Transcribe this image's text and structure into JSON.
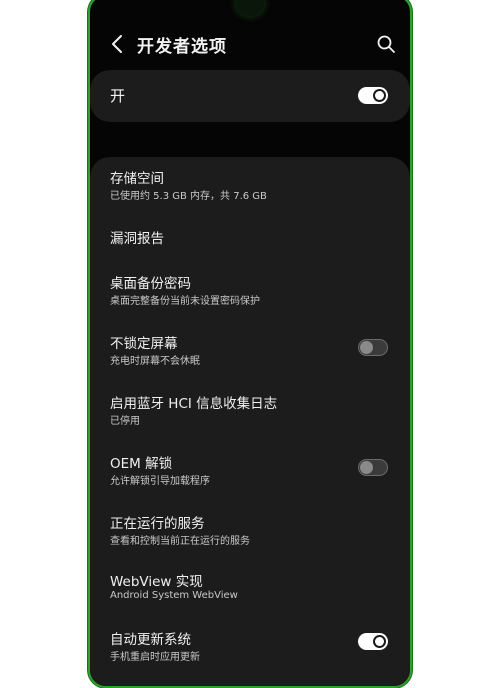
{
  "header": {
    "title": "开发者选项",
    "back_icon": "chevron-left-icon",
    "search_icon": "search-icon"
  },
  "master": {
    "label": "开",
    "enabled": true
  },
  "settings": [
    {
      "title": "存储空间",
      "subtitle": "已使用约 5.3 GB 内存，共 7.6 GB"
    },
    {
      "title": "漏洞报告",
      "subtitle": ""
    },
    {
      "title": "桌面备份密码",
      "subtitle": "桌面完整备份当前未设置密码保护"
    },
    {
      "title": "不锁定屏幕",
      "subtitle": "充电时屏幕不会休眠",
      "toggle": false
    },
    {
      "title": "启用蓝牙 HCI 信息收集日志",
      "subtitle": "已停用"
    },
    {
      "title": "OEM 解锁",
      "subtitle": "允许解锁引导加载程序",
      "toggle": false
    },
    {
      "title": "正在运行的服务",
      "subtitle": "查看和控制当前正在运行的服务"
    },
    {
      "title": "WebView 实现",
      "subtitle": "Android System WebView"
    },
    {
      "title": "自动更新系统",
      "subtitle": "手机重启时应用更新",
      "toggle": true
    }
  ],
  "colors": {
    "frame_accent": "#2ea02e",
    "background": "#050505",
    "card": "#1c1c1c"
  }
}
